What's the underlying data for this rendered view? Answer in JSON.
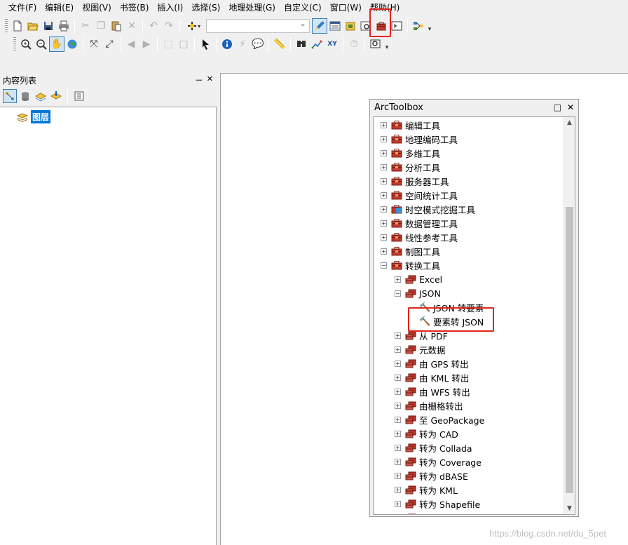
{
  "menu": [
    "文件(F)",
    "编辑(E)",
    "视图(V)",
    "书签(B)",
    "插入(I)",
    "选择(S)",
    "地理处理(G)",
    "自定义(C)",
    "窗口(W)",
    "帮助(H)"
  ],
  "toc": {
    "title": "内容列表",
    "pin": "ᅲ",
    "close": "✕",
    "layer_label": "图层"
  },
  "toolbox": {
    "title": "ArcToolbox",
    "maximize": "□",
    "close": "✕",
    "items": [
      {
        "label": "编辑工具",
        "level": 0,
        "expander": "+",
        "kind": "box"
      },
      {
        "label": "地理编码工具",
        "level": 0,
        "expander": "+",
        "kind": "box"
      },
      {
        "label": "多维工具",
        "level": 0,
        "expander": "+",
        "kind": "box"
      },
      {
        "label": "分析工具",
        "level": 0,
        "expander": "+",
        "kind": "box"
      },
      {
        "label": "服务器工具",
        "level": 0,
        "expander": "+",
        "kind": "box"
      },
      {
        "label": "空间统计工具",
        "level": 0,
        "expander": "+",
        "kind": "box"
      },
      {
        "label": "时空模式挖掘工具",
        "level": 0,
        "expander": "+",
        "kind": "box-blue"
      },
      {
        "label": "数据管理工具",
        "level": 0,
        "expander": "+",
        "kind": "box"
      },
      {
        "label": "线性参考工具",
        "level": 0,
        "expander": "+",
        "kind": "box"
      },
      {
        "label": "制图工具",
        "level": 0,
        "expander": "+",
        "kind": "box"
      },
      {
        "label": "转换工具",
        "level": 0,
        "expander": "−",
        "kind": "box"
      },
      {
        "label": "Excel",
        "level": 1,
        "expander": "+",
        "kind": "set"
      },
      {
        "label": "JSON",
        "level": 1,
        "expander": "−",
        "kind": "set"
      },
      {
        "label": "JSON 转要素",
        "level": 2,
        "expander": "",
        "kind": "tool"
      },
      {
        "label": "要素转 JSON",
        "level": 2,
        "expander": "",
        "kind": "tool"
      },
      {
        "label": "从 PDF",
        "level": 1,
        "expander": "+",
        "kind": "set"
      },
      {
        "label": "元数据",
        "level": 1,
        "expander": "+",
        "kind": "set"
      },
      {
        "label": "由 GPS 转出",
        "level": 1,
        "expander": "+",
        "kind": "set"
      },
      {
        "label": "由 KML 转出",
        "level": 1,
        "expander": "+",
        "kind": "set"
      },
      {
        "label": "由 WFS 转出",
        "level": 1,
        "expander": "+",
        "kind": "set"
      },
      {
        "label": "由栅格转出",
        "level": 1,
        "expander": "+",
        "kind": "set"
      },
      {
        "label": "至 GeoPackage",
        "level": 1,
        "expander": "+",
        "kind": "set"
      },
      {
        "label": "转为 CAD",
        "level": 1,
        "expander": "+",
        "kind": "set"
      },
      {
        "label": "转为 Collada",
        "level": 1,
        "expander": "+",
        "kind": "set"
      },
      {
        "label": "转为 Coverage",
        "level": 1,
        "expander": "+",
        "kind": "set"
      },
      {
        "label": "转为 dBASE",
        "level": 1,
        "expander": "+",
        "kind": "set"
      },
      {
        "label": "转为 KML",
        "level": 1,
        "expander": "+",
        "kind": "set"
      },
      {
        "label": "转为 Shapefile",
        "level": 1,
        "expander": "+",
        "kind": "set"
      },
      {
        "label": "转为栅格",
        "level": 1,
        "expander": "+",
        "kind": "set"
      }
    ]
  },
  "watermark": "https://blog.csdn.net/du_5pet",
  "colors": {
    "highlight": "#e0241b",
    "selection": "#0078d7",
    "toolbox_red": "#b8342b"
  }
}
